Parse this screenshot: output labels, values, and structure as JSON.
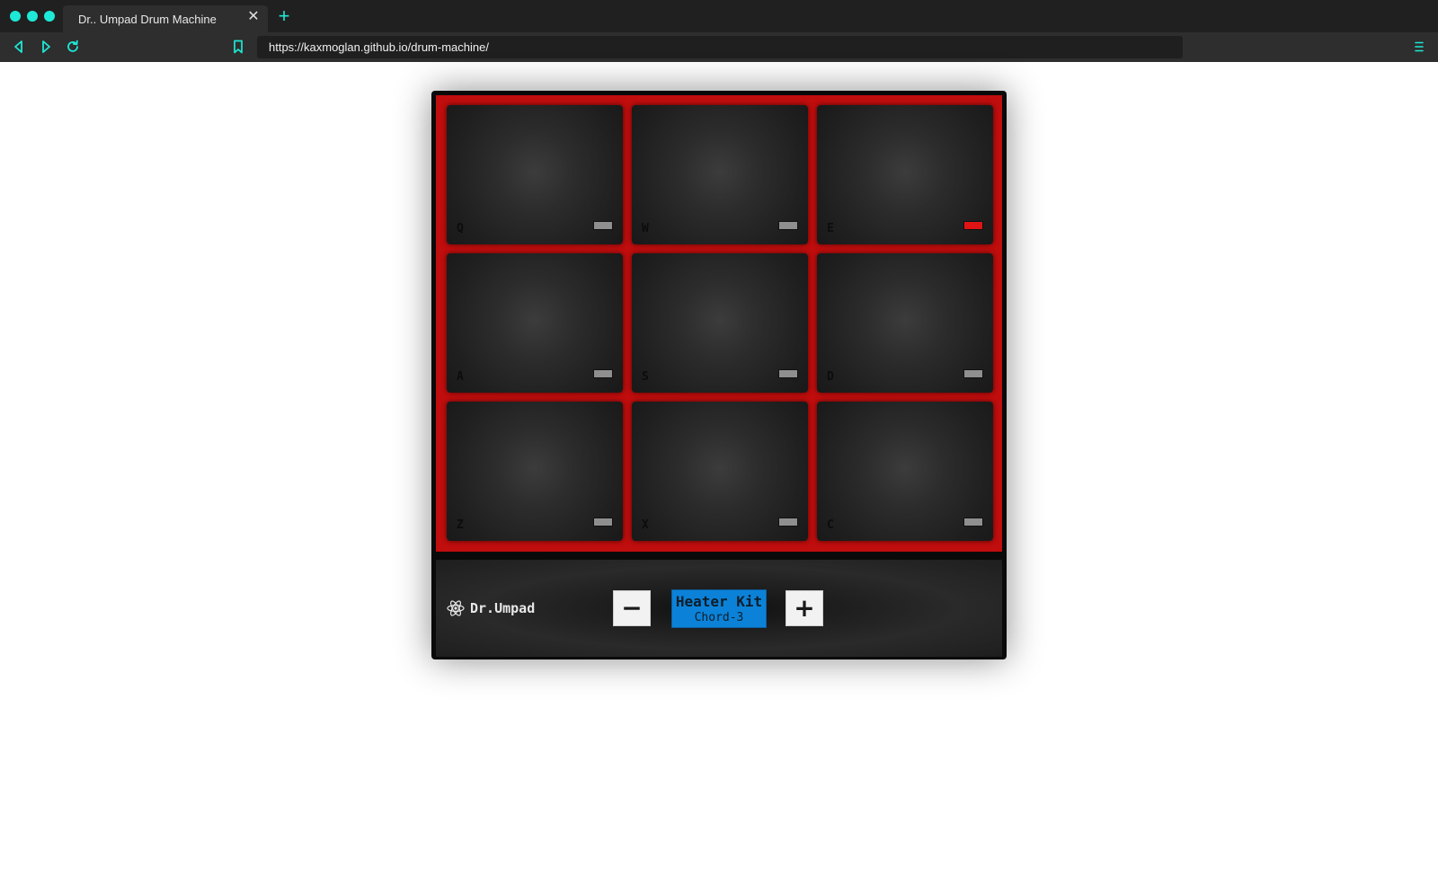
{
  "browser": {
    "tab_title": "Dr.. Umpad Drum Machine",
    "tab_close_label": "✕",
    "new_tab_label": "+",
    "url": "https://kaxmoglan.github.io/drum-machine/",
    "accent_color": "#1de9d6"
  },
  "machine": {
    "pads": [
      {
        "key": "Q",
        "active": false
      },
      {
        "key": "W",
        "active": false
      },
      {
        "key": "E",
        "active": true
      },
      {
        "key": "A",
        "active": false
      },
      {
        "key": "S",
        "active": false
      },
      {
        "key": "D",
        "active": false
      },
      {
        "key": "Z",
        "active": false
      },
      {
        "key": "X",
        "active": false
      },
      {
        "key": "C",
        "active": false
      }
    ],
    "brand_name": "Dr.Umpad",
    "brand_icon": "atom-icon",
    "decrease_label": "−",
    "increase_label": "+",
    "display": {
      "kit": "Heater Kit",
      "sound": "Chord-3"
    },
    "colors": {
      "frame": "#c00d0d",
      "led_active": "#e01414",
      "led_idle": "#8f8f8f",
      "display_bg": "#0b82d8"
    }
  }
}
